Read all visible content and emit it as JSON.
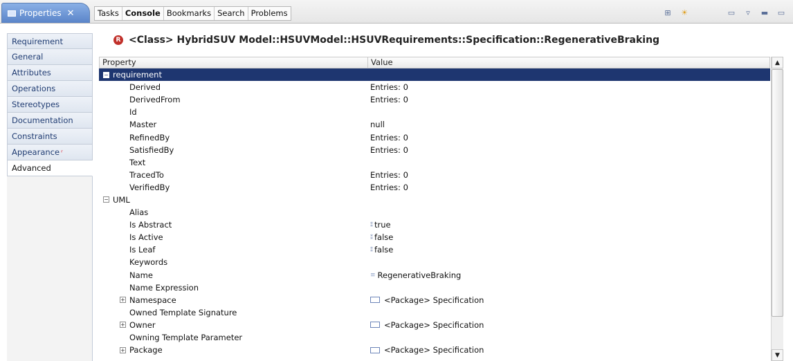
{
  "tabs": {
    "active_label": "Properties",
    "others": [
      "Tasks",
      "Console",
      "Bookmarks",
      "Search",
      "Problems"
    ]
  },
  "sidebar": {
    "items": [
      {
        "label": "Requirement"
      },
      {
        "label": "General"
      },
      {
        "label": "Attributes"
      },
      {
        "label": "Operations"
      },
      {
        "label": "Stereotypes"
      },
      {
        "label": "Documentation"
      },
      {
        "label": "Constraints"
      },
      {
        "label": "Appearance"
      },
      {
        "label": "Advanced"
      }
    ],
    "active": "Advanced"
  },
  "header": {
    "badge": "R",
    "title": "<Class> HybridSUV Model::HSUVModel::HSUVRequirements::Specification::RegenerativeBraking"
  },
  "table": {
    "columns": {
      "property": "Property",
      "value": "Value"
    },
    "rows": [
      {
        "property": "requirement",
        "value": "",
        "level": 0,
        "toggle": "minus",
        "selected": true
      },
      {
        "property": "Derived",
        "value": "Entries: 0",
        "level": 1
      },
      {
        "property": "DerivedFrom",
        "value": "Entries: 0",
        "level": 1
      },
      {
        "property": "Id",
        "value": "",
        "level": 1
      },
      {
        "property": "Master",
        "value": "null",
        "level": 1
      },
      {
        "property": "RefinedBy",
        "value": "Entries: 0",
        "level": 1
      },
      {
        "property": "SatisfiedBy",
        "value": "Entries: 0",
        "level": 1
      },
      {
        "property": "Text",
        "value": "",
        "level": 1
      },
      {
        "property": "TracedTo",
        "value": "Entries: 0",
        "level": 1
      },
      {
        "property": "VerifiedBy",
        "value": "Entries: 0",
        "level": 1
      },
      {
        "property": "UML",
        "value": "",
        "level": 0,
        "toggle": "minus"
      },
      {
        "property": "Alias",
        "value": "",
        "level": 1
      },
      {
        "property": "Is Abstract",
        "value": "true",
        "level": 1,
        "icon": "literal-icon"
      },
      {
        "property": "Is Active",
        "value": "false",
        "level": 1,
        "icon": "literal-icon"
      },
      {
        "property": "Is Leaf",
        "value": "false",
        "level": 1,
        "icon": "literal-icon"
      },
      {
        "property": "Keywords",
        "value": "",
        "level": 1
      },
      {
        "property": "Name",
        "value": "RegenerativeBraking",
        "level": 1,
        "icon": "string-icon"
      },
      {
        "property": "Name Expression",
        "value": "",
        "level": 1
      },
      {
        "property": "Namespace",
        "value": "<Package> Specification",
        "level": 1,
        "toggle": "plus",
        "icon": "package-icon"
      },
      {
        "property": "Owned Template Signature",
        "value": "",
        "level": 1
      },
      {
        "property": "Owner",
        "value": "<Package> Specification",
        "level": 1,
        "toggle": "plus",
        "icon": "package-icon"
      },
      {
        "property": "Owning Template Parameter",
        "value": "",
        "level": 1
      },
      {
        "property": "Package",
        "value": "<Package> Specification",
        "level": 1,
        "toggle": "plus",
        "icon": "package-icon"
      }
    ]
  }
}
